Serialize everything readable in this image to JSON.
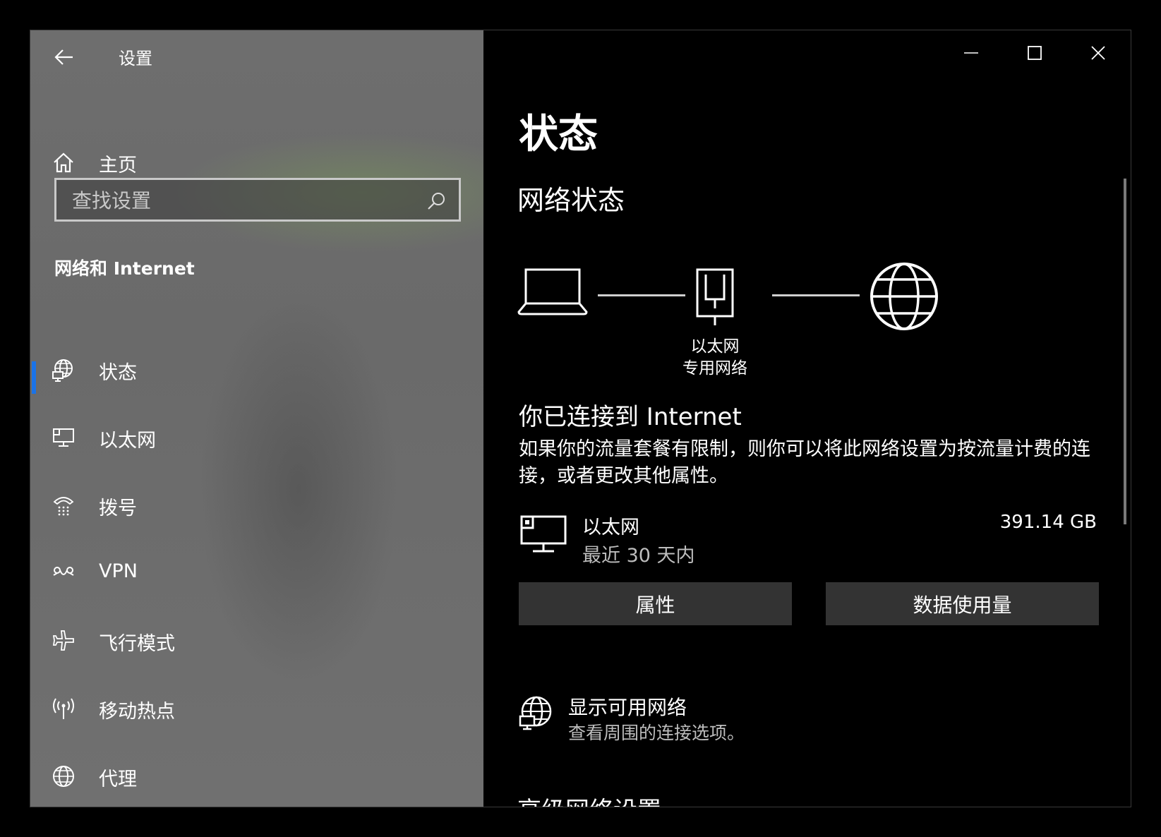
{
  "window": {
    "title": "设置",
    "controls": {
      "minimize": "minimize",
      "maximize": "maximize",
      "close": "close"
    }
  },
  "sidebar": {
    "home_label": "主页",
    "search_placeholder": "查找设置",
    "section_title": "网络和 Internet",
    "items": [
      {
        "label": "状态",
        "icon": "globe-network-icon",
        "selected": true
      },
      {
        "label": "以太网",
        "icon": "ethernet-icon",
        "selected": false
      },
      {
        "label": "拨号",
        "icon": "dialup-icon",
        "selected": false
      },
      {
        "label": "VPN",
        "icon": "vpn-icon",
        "selected": false
      },
      {
        "label": "飞行模式",
        "icon": "airplane-icon",
        "selected": false
      },
      {
        "label": "移动热点",
        "icon": "hotspot-icon",
        "selected": false
      },
      {
        "label": "代理",
        "icon": "globe-icon",
        "selected": false
      }
    ],
    "accent_color": "#1a73e8"
  },
  "main": {
    "page_title": "状态",
    "network_status_heading": "网络状态",
    "diagram": {
      "adapter_label": "以太网",
      "network_type": "专用网络"
    },
    "connection_title": "你已连接到 Internet",
    "connection_desc": "如果你的流量套餐有限制，则你可以将此网络设置为按流量计费的连接，或者更改其他属性。",
    "ethernet": {
      "name": "以太网",
      "period": "最近 30 天内",
      "usage": "391.14 GB"
    },
    "buttons": {
      "properties": "属性",
      "data_usage": "数据使用量"
    },
    "show_networks": {
      "title": "显示可用网络",
      "subtitle": "查看周围的连接选项。"
    },
    "advanced_heading": "高级网络设置"
  }
}
